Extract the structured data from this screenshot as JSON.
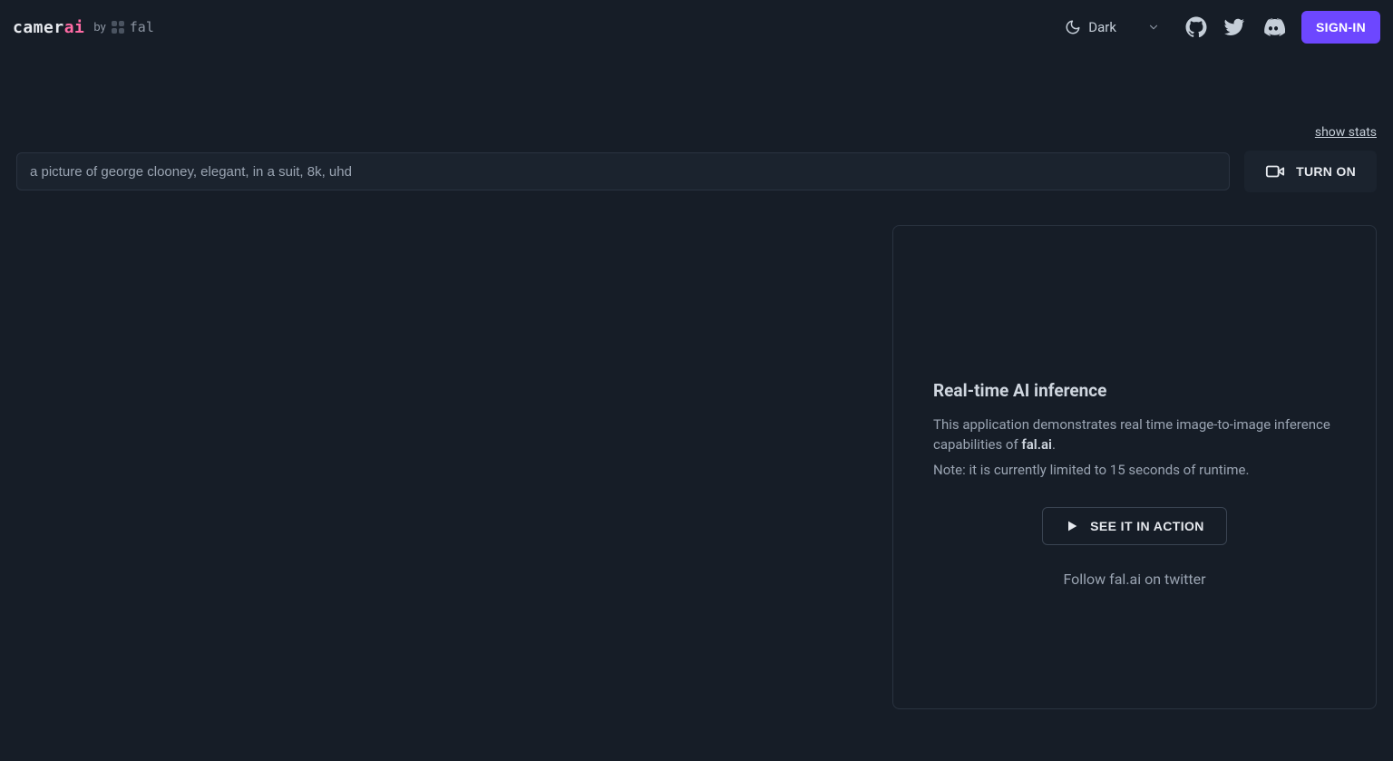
{
  "header": {
    "logo_part1": "camer",
    "logo_part2": "ai",
    "by_label": "by",
    "fal_name": "fal",
    "theme_label": "Dark",
    "signin_label": "SIGN-IN"
  },
  "toolbar": {
    "show_stats_label": "show stats",
    "prompt_value": "a picture of george clooney, elegant, in a suit, 8k, uhd",
    "turn_on_label": "TURN ON"
  },
  "card": {
    "title": "Real-time AI inference",
    "desc_prefix": "This application demonstrates real time image-to-image inference capabilities of ",
    "desc_brand": "fal.ai",
    "desc_suffix": ".",
    "note": "Note: it is currently limited to 15 seconds of runtime.",
    "action_label": "SEE IT IN ACTION",
    "follow_label": "Follow fal.ai on twitter"
  }
}
